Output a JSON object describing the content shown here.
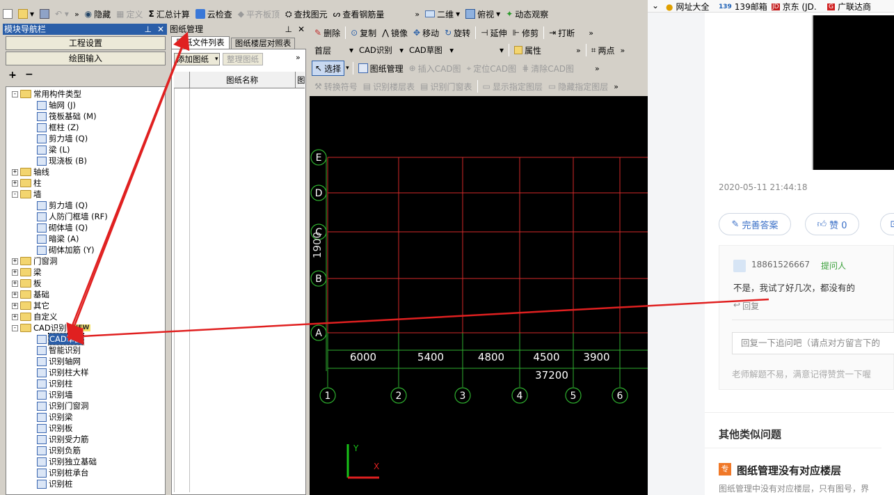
{
  "toolbar1": {
    "hide": "隐藏",
    "define": "定义",
    "sum": "汇总计算",
    "cloud_check": "云检查",
    "flat_top": "平齐板顶",
    "find": "查找图元",
    "view_rebar": "查看钢筋量",
    "view2d": "二维",
    "view_mode": "俯视",
    "dynamic": "动态观察"
  },
  "nav": {
    "title": "模块导航栏",
    "project_settings": "工程设置",
    "drawing_input": "绘图输入"
  },
  "tree": [
    {
      "label": "常用构件类型",
      "level": 0,
      "expander": "-",
      "icon": "folder"
    },
    {
      "label": "轴网 (J)",
      "level": 2,
      "icon": "grid"
    },
    {
      "label": "筏板基础 (M)",
      "level": 2,
      "icon": "grid"
    },
    {
      "label": "框柱 (Z)",
      "level": 2,
      "icon": "col"
    },
    {
      "label": "剪力墙 (Q)",
      "level": 2,
      "icon": "wall"
    },
    {
      "label": "梁 (L)",
      "level": 2,
      "icon": "beam"
    },
    {
      "label": "现浇板 (B)",
      "level": 2,
      "icon": "slab"
    },
    {
      "label": "轴线",
      "level": 0,
      "expander": "+",
      "icon": "folder"
    },
    {
      "label": "柱",
      "level": 0,
      "expander": "+",
      "icon": "folder"
    },
    {
      "label": "墙",
      "level": 0,
      "expander": "-",
      "icon": "folder"
    },
    {
      "label": "剪力墙 (Q)",
      "level": 2,
      "icon": "wall"
    },
    {
      "label": "人防门框墙 (RF)",
      "level": 2,
      "icon": "door"
    },
    {
      "label": "砌体墙 (Q)",
      "level": 2,
      "icon": "brick"
    },
    {
      "label": "暗梁 (A)",
      "level": 2,
      "icon": "beam"
    },
    {
      "label": "砌体加筋 (Y)",
      "level": 2,
      "icon": "rebar"
    },
    {
      "label": "门窗洞",
      "level": 0,
      "expander": "+",
      "icon": "folder"
    },
    {
      "label": "梁",
      "level": 0,
      "expander": "+",
      "icon": "folder"
    },
    {
      "label": "板",
      "level": 0,
      "expander": "+",
      "icon": "folder"
    },
    {
      "label": "基础",
      "level": 0,
      "expander": "+",
      "icon": "folder"
    },
    {
      "label": "其它",
      "level": 0,
      "expander": "+",
      "icon": "folder"
    },
    {
      "label": "自定义",
      "level": 0,
      "expander": "+",
      "icon": "folder"
    },
    {
      "label": "CAD识别",
      "level": 0,
      "expander": "-",
      "icon": "folder",
      "badge": "NEW"
    },
    {
      "label": "CAD草图",
      "level": 2,
      "icon": "cad",
      "selected": true
    },
    {
      "label": "智能识别",
      "level": 2,
      "icon": "cad"
    },
    {
      "label": "识别轴网",
      "level": 2,
      "icon": "cad"
    },
    {
      "label": "识别柱大样",
      "level": 2,
      "icon": "cad"
    },
    {
      "label": "识别柱",
      "level": 2,
      "icon": "cad"
    },
    {
      "label": "识别墙",
      "level": 2,
      "icon": "cad"
    },
    {
      "label": "识别门窗洞",
      "level": 2,
      "icon": "cad"
    },
    {
      "label": "识别梁",
      "level": 2,
      "icon": "cad"
    },
    {
      "label": "识别板",
      "level": 2,
      "icon": "cad"
    },
    {
      "label": "识别受力筋",
      "level": 2,
      "icon": "cad"
    },
    {
      "label": "识别负筋",
      "level": 2,
      "icon": "cad"
    },
    {
      "label": "识别独立基础",
      "level": 2,
      "icon": "cad"
    },
    {
      "label": "识别桩承台",
      "level": 2,
      "icon": "cad"
    },
    {
      "label": "识别桩",
      "level": 2,
      "icon": "cad"
    }
  ],
  "drawing_mgmt": {
    "title": "图纸管理",
    "tab_files": "图纸文件列表",
    "tab_floor": "图纸楼层对照表",
    "add_drawing": "添加图纸",
    "organize": "整理图纸",
    "col_name": "图纸名称",
    "col_more": "图"
  },
  "edit_toolbar": {
    "delete": "删除",
    "copy": "复制",
    "mirror": "镜像",
    "move": "移动",
    "rotate": "旋转",
    "extend": "延伸",
    "trim": "修剪",
    "break": "打断"
  },
  "floor_bar": {
    "floor": "首层",
    "cad_recog": "CAD识别",
    "cad_sketch": "CAD草图",
    "empty": "",
    "props": "属性",
    "two_points": "两点"
  },
  "cad_bar": {
    "select": "选择",
    "manage": "图纸管理",
    "insert": "插入CAD图",
    "locate": "定位CAD图",
    "clear": "清除CAD图"
  },
  "recog_bar": {
    "convert": "转换符号",
    "floor_table": "识别楼层表",
    "door_table": "识别门窗表",
    "show_layer": "显示指定图层",
    "hide_layer": "隐藏指定图层"
  },
  "cad": {
    "row_axes": [
      "E",
      "D",
      "C",
      "B",
      "A"
    ],
    "col_axes": [
      "1",
      "2",
      "3",
      "4",
      "5",
      "6"
    ],
    "spans": [
      "6000",
      "5400",
      "4800",
      "4500",
      "3900"
    ],
    "total": "37200",
    "vertical_dim": "1900",
    "ucs_x": "X",
    "ucs_y": "Y"
  },
  "browser": {
    "bookmarks": [
      "网址大全",
      "139邮箱",
      "京东 (JD.",
      "广联达商"
    ],
    "timestamp": "2020-05-11 21:44:18",
    "improve": "完善答案",
    "like": "赞 0",
    "user": "18861526667",
    "role": "提问人",
    "comment": "不是，我试了好几次，都没有的",
    "reply": "回复",
    "reply_placeholder": "回复一下追问吧（请点对方留言下的",
    "hint": "老师解题不易，满意记得赞赏一下喔",
    "similar_title": "其他类似问题",
    "similar_badge": "专",
    "similar_q": "图纸管理没有对应楼层",
    "similar_desc": "图纸管理中没有对应楼层，只有图号，界"
  },
  "colors": {
    "grid": "#d42a2a",
    "dim": "#2fb12f",
    "annot_arrow": "#e02020"
  }
}
